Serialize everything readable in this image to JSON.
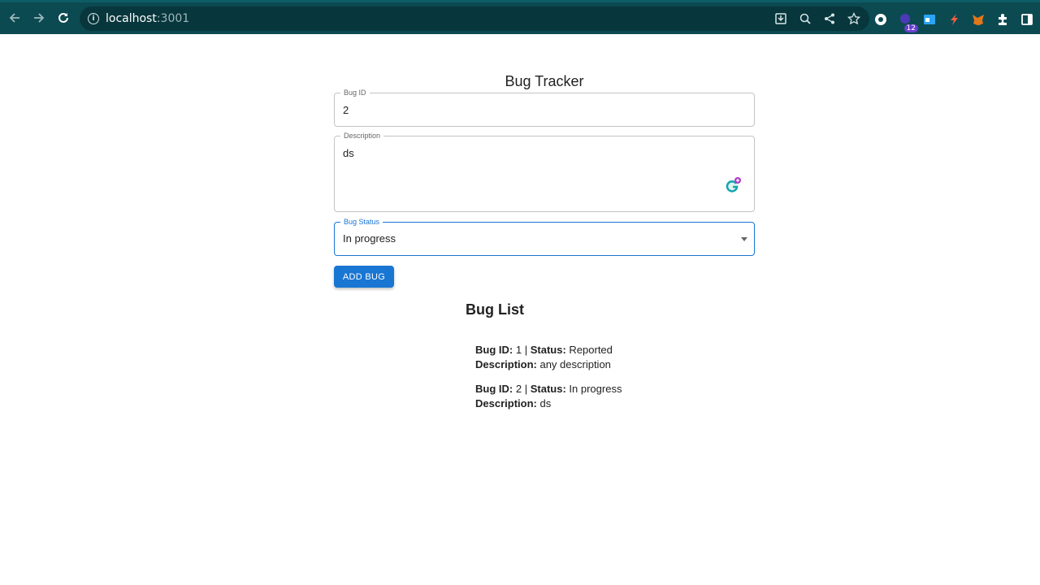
{
  "browser": {
    "url_host": "localhost",
    "url_port": ":3001",
    "extension_badge": "12"
  },
  "page": {
    "title": "Bug Tracker"
  },
  "form": {
    "bug_id": {
      "label": "Bug ID",
      "value": "2"
    },
    "description": {
      "label": "Description",
      "value": "ds"
    },
    "status": {
      "label": "Bug Status",
      "value": "In progress"
    },
    "add_button": "ADD BUG"
  },
  "list": {
    "title": "Bug List",
    "bug_id_label": "Bug ID:",
    "status_label": "Status:",
    "description_label": "Description:",
    "separator": "|",
    "items": [
      {
        "id": "1",
        "status": "Reported",
        "description": "any description"
      },
      {
        "id": "2",
        "status": "In progress",
        "description": "ds"
      }
    ]
  },
  "colors": {
    "browser_bar": "#0c4a52",
    "primary": "#1976d2"
  }
}
